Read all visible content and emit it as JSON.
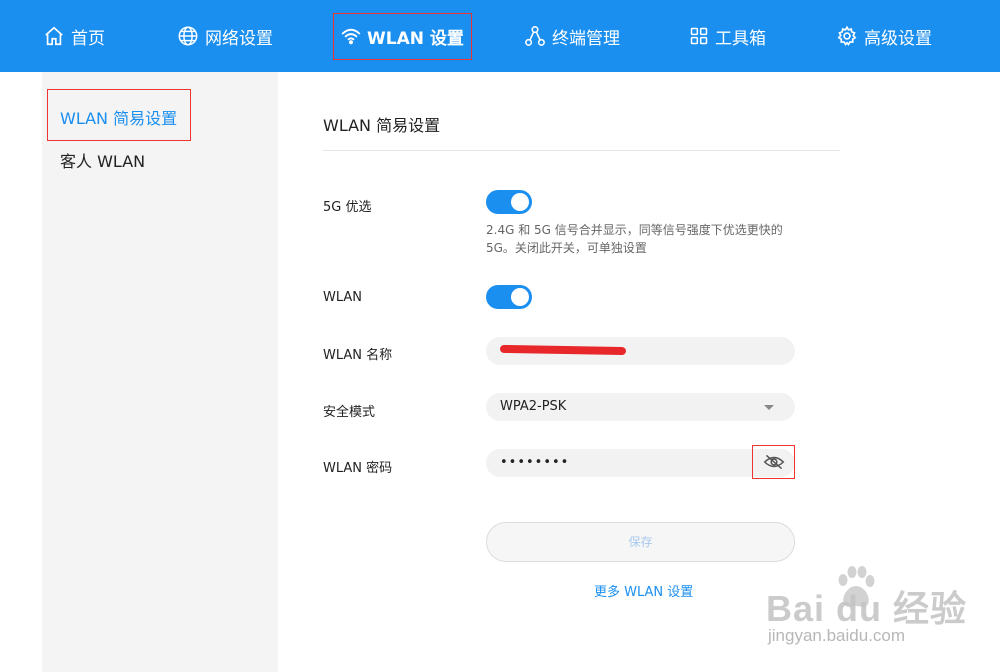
{
  "colors": {
    "accent": "#1b8ff0",
    "highlight_box": "#e33333",
    "sidebar_bg": "#f4f4f4",
    "field_bg": "#f2f2f2"
  },
  "nav": [
    {
      "label": "首页",
      "icon": "home-icon"
    },
    {
      "label": "网络设置",
      "icon": "globe-icon"
    },
    {
      "label": "WLAN 设置",
      "icon": "wifi-icon",
      "active": true
    },
    {
      "label": "终端管理",
      "icon": "devices-icon"
    },
    {
      "label": "工具箱",
      "icon": "grid-icon"
    },
    {
      "label": "高级设置",
      "icon": "gear-icon"
    }
  ],
  "sidebar": {
    "items": [
      {
        "label": "WLAN 简易设置",
        "active": true
      },
      {
        "label": "客人 WLAN"
      }
    ]
  },
  "main": {
    "title": "WLAN 简易设置",
    "band_steering": {
      "label": "5G 优选",
      "enabled": true,
      "description": "2.4G 和 5G 信号合并显示，同等信号强度下优选更快的 5G。关闭此开关，可单独设置"
    },
    "wlan": {
      "label": "WLAN",
      "enabled": true
    },
    "ssid": {
      "label": "WLAN 名称",
      "value": ""
    },
    "security": {
      "label": "安全模式",
      "value": "WPA2-PSK"
    },
    "password": {
      "label": "WLAN 密码",
      "value": "••••••••",
      "toggle_icon": "eye-off-icon"
    },
    "save_label": "保存",
    "more_link": "更多 WLAN 设置"
  },
  "watermark": {
    "logo": "Bai  du 经验",
    "url": "jingyan.baidu.com"
  }
}
